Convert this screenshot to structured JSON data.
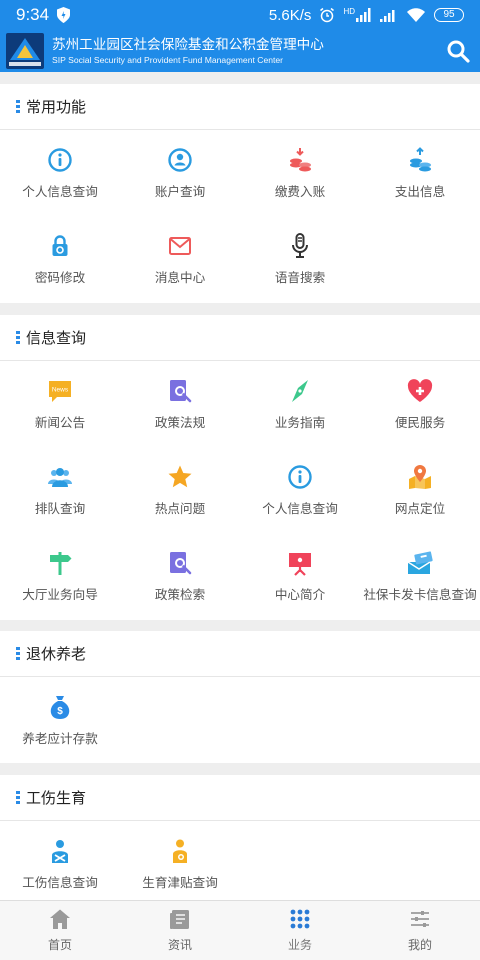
{
  "status_bar": {
    "time": "9:34",
    "network_speed": "5.6K/s",
    "signal_label": "HD",
    "battery": "95"
  },
  "header": {
    "title": "苏州工业园区社会保险基金和公积金管理中心",
    "subtitle": "SIP Social Security and Provident Fund Management Center",
    "brand_color": "#1f8be8"
  },
  "sections": [
    {
      "title": "常用功能",
      "items": [
        {
          "label": "个人信息查询",
          "icon": "info-circle-icon",
          "color": "#2a9be0"
        },
        {
          "label": "账户查询",
          "icon": "user-circle-icon",
          "color": "#2a9be0"
        },
        {
          "label": "缴费入账",
          "icon": "coin-deposit-icon",
          "color": "#ee5a5a"
        },
        {
          "label": "支出信息",
          "icon": "coin-withdraw-icon",
          "color": "#2a9be0"
        },
        {
          "label": "密码修改",
          "icon": "lock-icon",
          "color": "#2a9be0"
        },
        {
          "label": "消息中心",
          "icon": "mail-icon",
          "color": "#ee5a5a"
        },
        {
          "label": "语音搜索",
          "icon": "microphone-icon",
          "color": "#333333"
        }
      ]
    },
    {
      "title": "信息查询",
      "items": [
        {
          "label": "新闻公告",
          "icon": "news-icon",
          "color": "#f5b024",
          "badge": "News"
        },
        {
          "label": "政策法规",
          "icon": "document-search-icon",
          "color": "#7a70e0"
        },
        {
          "label": "业务指南",
          "icon": "compass-icon",
          "color": "#3cc88c"
        },
        {
          "label": "便民服务",
          "icon": "heart-plus-icon",
          "color": "#f0435a"
        },
        {
          "label": "排队查询",
          "icon": "people-icon",
          "color": "#2a9be0"
        },
        {
          "label": "热点问题",
          "icon": "star-icon",
          "color": "#f5a623"
        },
        {
          "label": "个人信息查询",
          "icon": "info-circle-icon",
          "color": "#2a9be0"
        },
        {
          "label": "网点定位",
          "icon": "location-map-icon",
          "color": "#f07840"
        },
        {
          "label": "大厅业务向导",
          "icon": "signpost-icon",
          "color": "#3cc88c"
        },
        {
          "label": "政策检索",
          "icon": "document-search-icon",
          "color": "#7a70e0"
        },
        {
          "label": "中心简介",
          "icon": "presentation-board-icon",
          "color": "#f0435a"
        },
        {
          "label": "社保卡发卡信息查询",
          "icon": "card-envelope-icon",
          "color": "#2aa6e0"
        }
      ]
    },
    {
      "title": "退休养老",
      "items": [
        {
          "label": "养老应计存款",
          "icon": "money-bag-icon",
          "color": "#2a8be6"
        }
      ]
    },
    {
      "title": "工伤生育",
      "items": [
        {
          "label": "工伤信息查询",
          "icon": "injured-person-icon",
          "color": "#2a9be0"
        },
        {
          "label": "生育津贴查询",
          "icon": "maternity-icon",
          "color": "#f5b024"
        }
      ]
    }
  ],
  "bottom_nav": [
    {
      "label": "首页",
      "icon": "home-icon"
    },
    {
      "label": "资讯",
      "icon": "news-list-icon"
    },
    {
      "label": "业务",
      "icon": "grid-dots-icon",
      "active": true
    },
    {
      "label": "我的",
      "icon": "sliders-icon"
    }
  ]
}
